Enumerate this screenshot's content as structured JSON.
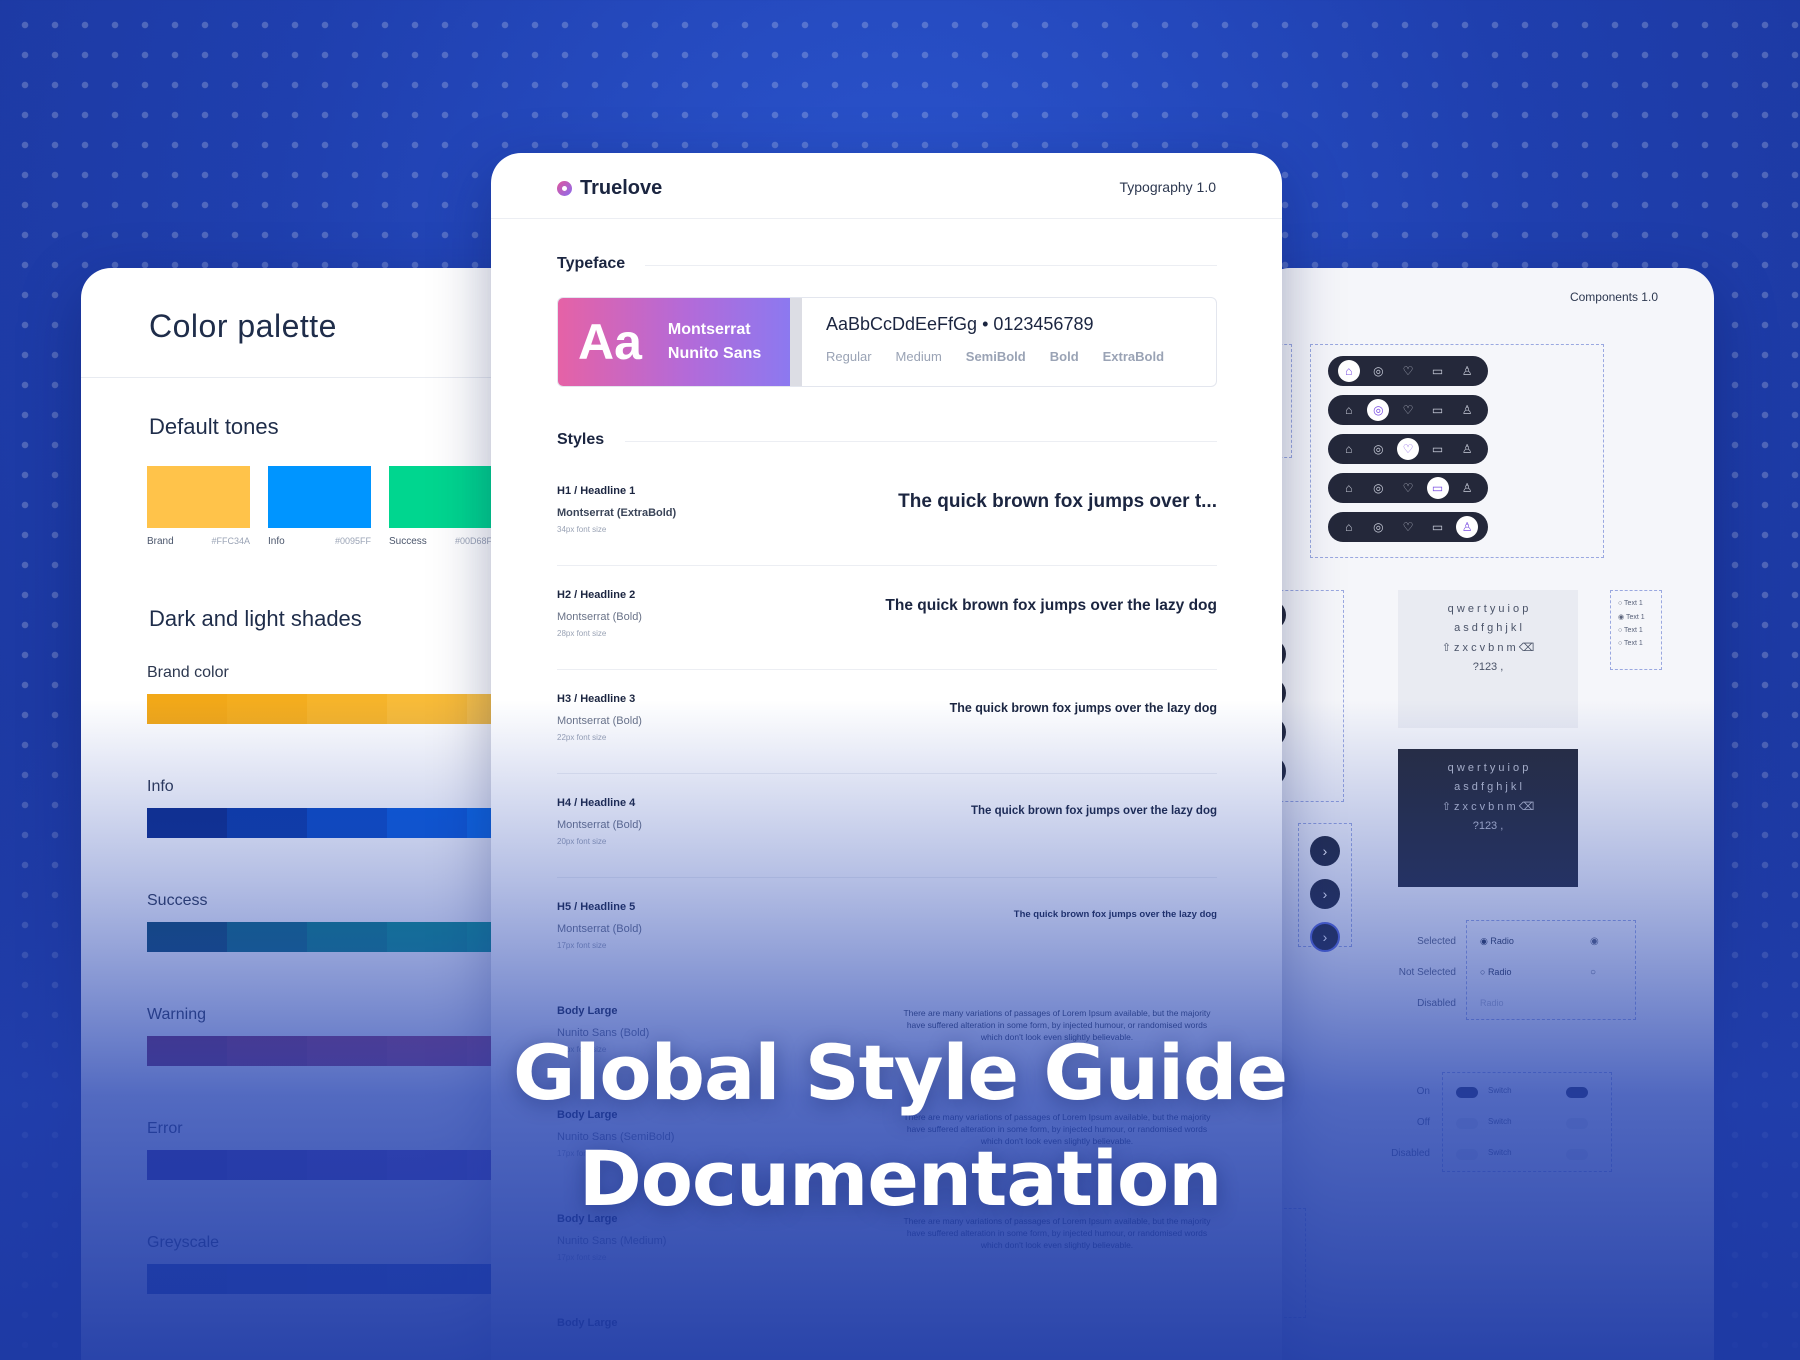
{
  "left_card": {
    "title": "Color palette",
    "default_tones_title": "Default tones",
    "tones": [
      {
        "name": "Brand",
        "hex": "#FFC34A",
        "color": "#FFC34A"
      },
      {
        "name": "Info",
        "hex": "#0095FF",
        "color": "#0095FF"
      },
      {
        "name": "Success",
        "hex": "#00D68F",
        "color": "#00D68F"
      }
    ],
    "shades_title": "Dark and light shades",
    "shades": [
      {
        "name": "Brand color",
        "colors": [
          "#f2a818",
          "#f4ad1e",
          "#f6b42a",
          "#f8bb38",
          "#fac247"
        ]
      },
      {
        "name": "Info",
        "colors": [
          "#0b2c8a",
          "#0a3aa6",
          "#0a4ac2",
          "#0a5ad8",
          "#0a6ae6"
        ]
      },
      {
        "name": "Success",
        "colors": [
          "#0b4a6a",
          "#0b6a7a",
          "#0a8080",
          "#0a9088",
          "#0a9a8c"
        ]
      },
      {
        "name": "Warning",
        "colors": [
          "#7a2a5c",
          "#8a3060",
          "#973766",
          "#a03c6a",
          "#a8416e"
        ]
      },
      {
        "name": "Error",
        "colors": [
          "#3a2890",
          "#45309a",
          "#5038a4",
          "#5b40ae",
          "#6648b8"
        ]
      },
      {
        "name": "Greyscale",
        "colors": [
          "#1b3a9c",
          "#1e3fa4",
          "#2044aa",
          "#2248b0",
          "#244cb4"
        ]
      }
    ]
  },
  "center_card": {
    "brand": "Truelove",
    "version": "Typography 1.0",
    "typeface_title": "Typeface",
    "typeface": {
      "aa": "Aa",
      "font_1": "Montserrat",
      "font_2": "Nunito Sans",
      "sample": "AaBbCcDdEeFfGg  •  0123456789",
      "weights": [
        "Regular",
        "Medium",
        "SemiBold",
        "Bold",
        "ExtraBold"
      ]
    },
    "styles_title": "Styles",
    "styles": [
      {
        "label": "H1 / Headline 1",
        "family": "Montserrat (ExtraBold)",
        "size": "34px font size",
        "sample": "The quick brown fox jumps over t..."
      },
      {
        "label": "H2 / Headline 2",
        "family": "Montserrat (Bold)",
        "size": "28px font size",
        "sample": "The quick brown fox jumps over the lazy dog"
      },
      {
        "label": "H3 / Headline 3",
        "family": "Montserrat (Bold)",
        "size": "22px font size",
        "sample": "The quick brown fox jumps over the lazy dog"
      },
      {
        "label": "H4 / Headline 4",
        "family": "Montserrat (Bold)",
        "size": "20px font size",
        "sample": "The quick brown fox jumps over the lazy dog"
      },
      {
        "label": "H5 / Headline 5",
        "family": "Montserrat (Bold)",
        "size": "17px font size",
        "sample": "The quick brown fox jumps over the lazy dog"
      }
    ],
    "body_styles": [
      {
        "label": "Body Large",
        "family": "Nunito Sans (Bold)",
        "size": "17px font size",
        "sample": "There are many variations of passages of Lorem Ipsum available, but the majority have suffered alteration in some form, by injected humour, or randomised words which don't look even slightly believable."
      },
      {
        "label": "Body Large",
        "family": "Nunito Sans (SemiBold)",
        "size": "17px font size",
        "sample": "There are many variations of passages of Lorem Ipsum available, but the majority have suffered alteration in some form, by injected humour, or randomised words which don't look even slightly believable."
      },
      {
        "label": "Body Large",
        "family": "Nunito Sans (Medium)",
        "size": "17px font size",
        "sample": "There are many variations of passages of Lorem Ipsum available, but the majority have suffered alteration in some form, by injected humour, or randomised words which don't look even slightly believable."
      },
      {
        "label": "Body Large",
        "family": "",
        "size": "",
        "sample": ""
      }
    ]
  },
  "right_card": {
    "title": "Components 1.0",
    "keyboard_rows": [
      "q w e r t y u i o p",
      "a s d f g h j k l",
      "⇧ z x c v b n m ⌫",
      "?123 ,"
    ],
    "radio_states": [
      "Selected",
      "Not Selected",
      "Disabled"
    ],
    "radio_label": "Radio",
    "switch_states": [
      "On",
      "Off",
      "Disabled"
    ],
    "switch_label": "Switch",
    "checkbox_label": "Text 1"
  },
  "hero": {
    "line_1": "Global Style Guide",
    "line_2": "Documentation"
  }
}
